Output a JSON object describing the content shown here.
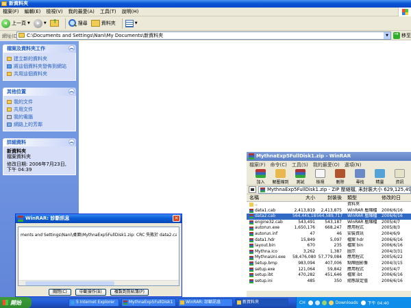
{
  "explorer": {
    "title": "新資料夾",
    "menu": [
      "檔案(F)",
      "編輯(E)",
      "檢視(V)",
      "我的最愛(A)",
      "工具(T)",
      "說明(H)"
    ],
    "toolbar": {
      "back": "上一頁",
      "search": "搜尋",
      "folders": "資料夾"
    },
    "address": {
      "label": "網址(D)",
      "path": "C:\\Documents and Settings\\Nani\\My Documents\\新資料夾",
      "go": "移至"
    },
    "panes": {
      "tasks": {
        "title": "檔案及資料夾工作",
        "items": [
          "建立新的資料夾",
          "將這個資料夾發佈到網站",
          "共用這個資料夾"
        ]
      },
      "places": {
        "title": "其他位置",
        "items": [
          "我的文件",
          "共用文件",
          "我的電腦",
          "網路上的芳鄰"
        ]
      },
      "details": {
        "title": "詳細資料",
        "name": "新資料夾",
        "type": "檔案資料夾",
        "modified": "修改日期: 2006年7月23日, 下午 04:39"
      }
    },
    "mark": "2"
  },
  "winrar": {
    "title": "MythnaExp5FullDisk1.zip - WinRAR",
    "menu": [
      "檔案(F)",
      "命令(C)",
      "工具(S)",
      "我的最愛(O)",
      "選項(N)"
    ],
    "tools": [
      "加入",
      "解壓縮到",
      "測試",
      "檢視",
      "刪除",
      "尋找",
      "精靈",
      "資訊"
    ],
    "path": "MythnaExp5FullDisk1.zip - ZIP 壓縮檔, 未封裝大小 629,125,493 位元組",
    "columns": [
      "名稱",
      "大小",
      "封裝後",
      "類型",
      "修改的日"
    ],
    "rows": [
      {
        "name": "..",
        "size": "",
        "packed": "",
        "type": "資料夾",
        "mod": ""
      },
      {
        "name": "data1.cab",
        "size": "2,413,819",
        "packed": "2,413,875",
        "type": "WinRAR 壓縮檔",
        "mod": "2006/6/16"
      },
      {
        "name": "data2.cab",
        "size": "564,445,184",
        "packed": "564,589,717",
        "type": "WinRAR 壓縮檔",
        "mod": "2006/6/16"
      },
      {
        "name": "engine32.cab",
        "size": "543,491",
        "packed": "543,187",
        "type": "WinRAR 壓縮檔",
        "mod": "2005/4/7"
      },
      {
        "name": "autorun.exe",
        "size": "1,650,176",
        "packed": "668,247",
        "type": "應用程式",
        "mod": "2005/8/3"
      },
      {
        "name": "autorun.inf",
        "size": "47",
        "packed": "46",
        "type": "安裝資訊",
        "mod": "2004/6/9"
      },
      {
        "name": "data1.hdr",
        "size": "15,849",
        "packed": "5,097",
        "type": "檔案 hdr",
        "mod": "2006/6/16"
      },
      {
        "name": "layout.bin",
        "size": "670",
        "packed": "235",
        "type": "檔案 bin",
        "mod": "2006/6/16"
      },
      {
        "name": "Mythna.ico",
        "size": "3,262",
        "packed": "1,387",
        "type": "圖示",
        "mod": "2004/3/31"
      },
      {
        "name": "MythnaUni.exe",
        "size": "58,476,080",
        "packed": "57,779,084",
        "type": "應用程式",
        "mod": "2005/6/22"
      },
      {
        "name": "Setup.bmp",
        "size": "983,094",
        "packed": "407,006",
        "type": "點陣圖影像",
        "mod": "2004/3/15"
      },
      {
        "name": "setup.exe",
        "size": "121,064",
        "packed": "59,842",
        "type": "應用程式",
        "mod": "2005/4/7"
      },
      {
        "name": "setup.ibt",
        "size": "470,282",
        "packed": "451,646",
        "type": "檔案 ibt",
        "mod": "2006/6/16"
      },
      {
        "name": "setup.ini",
        "size": "485",
        "packed": "350",
        "type": "組態設定值",
        "mod": "2006/6/16"
      }
    ]
  },
  "dialog": {
    "title": "WinRAR: 診斷訊息",
    "message": "ments and Settings\\Nani\\桌面\\MythnaExp5FullDisk1.zip: CRC 失敗於 data2.cab。檔案損壞",
    "buttons": [
      "關閉(C)",
      "中斷操作(B)",
      "複製到剪貼簿(P)"
    ]
  },
  "taskbar": {
    "start": "開始",
    "buttons": [
      "5 Internet Explorer",
      "MythnaExp5FullDisk1",
      "WinRAR: 診斷訊息",
      "新資料夾"
    ],
    "tray": {
      "lang": "CH",
      "downloads": "Downloads",
      "time": "下午 04:40"
    }
  }
}
